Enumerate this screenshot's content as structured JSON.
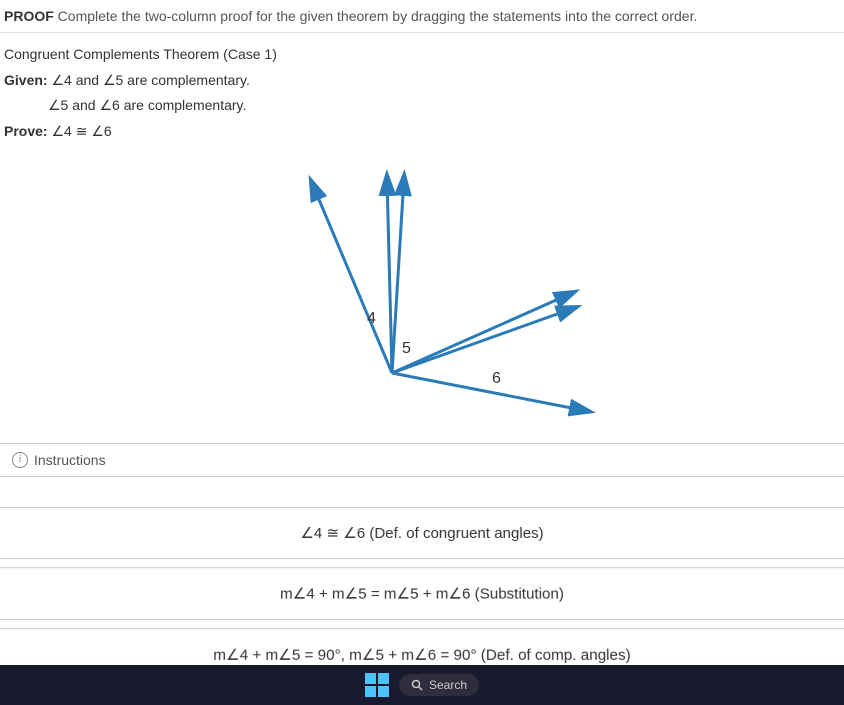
{
  "header": {
    "proof_label": "PROOF",
    "proof_instruction": "Complete the two-column proof for the given theorem by dragging the statements into the correct order."
  },
  "problem": {
    "theorem_title": "Congruent Complements Theorem (Case 1)",
    "given_label": "Given:",
    "given_line1": "∠4 and ∠5 are complementary.",
    "given_line2": "∠5 and ∠6 are complementary.",
    "prove_label": "Prove:",
    "prove_text": "∠4 ≅ ∠6"
  },
  "diagram": {
    "label4": "4",
    "label5": "5",
    "label6": "6"
  },
  "instructions": {
    "label": "Instructions"
  },
  "statements": {
    "s1": "∠4 ≅ ∠6 (Def. of congruent angles)",
    "s2": "m∠4 + m∠5 = m∠5 + m∠6 (Substitution)",
    "s3": "m∠4 + m∠5 = 90°,  m∠5 + m∠6 = 90° (Def. of comp. angles)"
  },
  "taskbar": {
    "search_label": "Search"
  }
}
